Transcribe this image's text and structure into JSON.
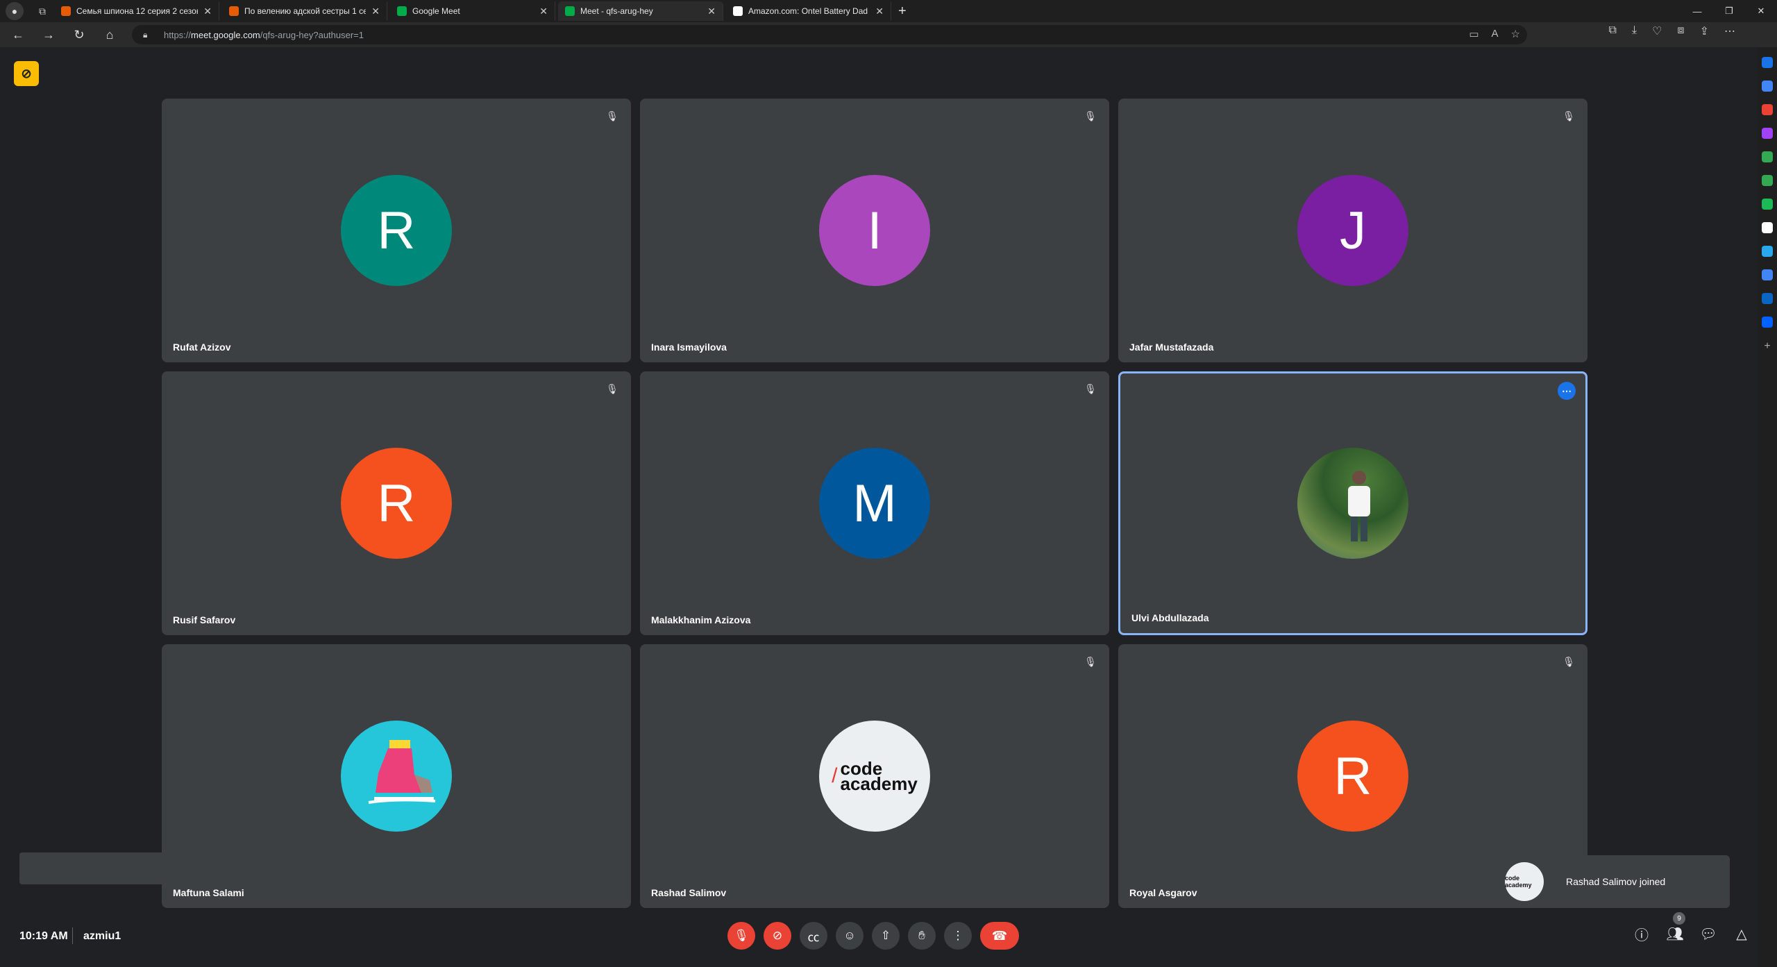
{
  "browser": {
    "tabs": [
      {
        "title": "Семья шпиона 12 серия 2 сезон",
        "favicon_color": "#e65c00"
      },
      {
        "title": "По велению адской сестры 1 се",
        "favicon_color": "#e65c00"
      },
      {
        "title": "Google Meet",
        "favicon_color": "#00ac47"
      },
      {
        "title": "Meet - qfs-arug-hey",
        "favicon_color": "#00ac47",
        "active": true
      },
      {
        "title": "Amazon.com: Ontel Battery Dad",
        "favicon_color": "#ffffff"
      }
    ],
    "url_prefix": "https://",
    "url_host": "meet.google.com",
    "url_path": "/qfs-arug-hey?authuser=1"
  },
  "meeting": {
    "time": "10:19 AM",
    "code": "azmiu1",
    "participant_count": "9",
    "toast_text": "Rashad Salimov joined",
    "toast_avatar_text": "code academy"
  },
  "participants": [
    {
      "name": "Rufat Azizov",
      "initial": "R",
      "color": "#00897b",
      "muted": true
    },
    {
      "name": "Inara Ismayilova",
      "initial": "I",
      "color": "#ab47bc",
      "muted": true
    },
    {
      "name": "Jafar Mustafazada",
      "initial": "J",
      "color": "#7b1fa2",
      "muted": true
    },
    {
      "name": "Rusif Safarov",
      "initial": "R",
      "color": "#f4511e",
      "muted": true
    },
    {
      "name": "Malakkhanim Azizova",
      "initial": "M",
      "color": "#01579b",
      "muted": true
    },
    {
      "name": "Ulvi Abdullazada",
      "initial": "",
      "color": "#4f7d3a",
      "muted": false,
      "highlighted": true,
      "avatar": "photo"
    },
    {
      "name": "Maftuna Salami",
      "initial": "",
      "color": "#26c6da",
      "muted": false,
      "avatar": "skate"
    },
    {
      "name": "Rashad Salimov",
      "initial": "",
      "color": "#eceff1",
      "muted": true,
      "avatar": "code-academy",
      "logo_line1": "code",
      "logo_line2": "academy"
    },
    {
      "name": "Royal Asgarov",
      "initial": "R",
      "color": "#f4511e",
      "muted": true
    }
  ]
}
